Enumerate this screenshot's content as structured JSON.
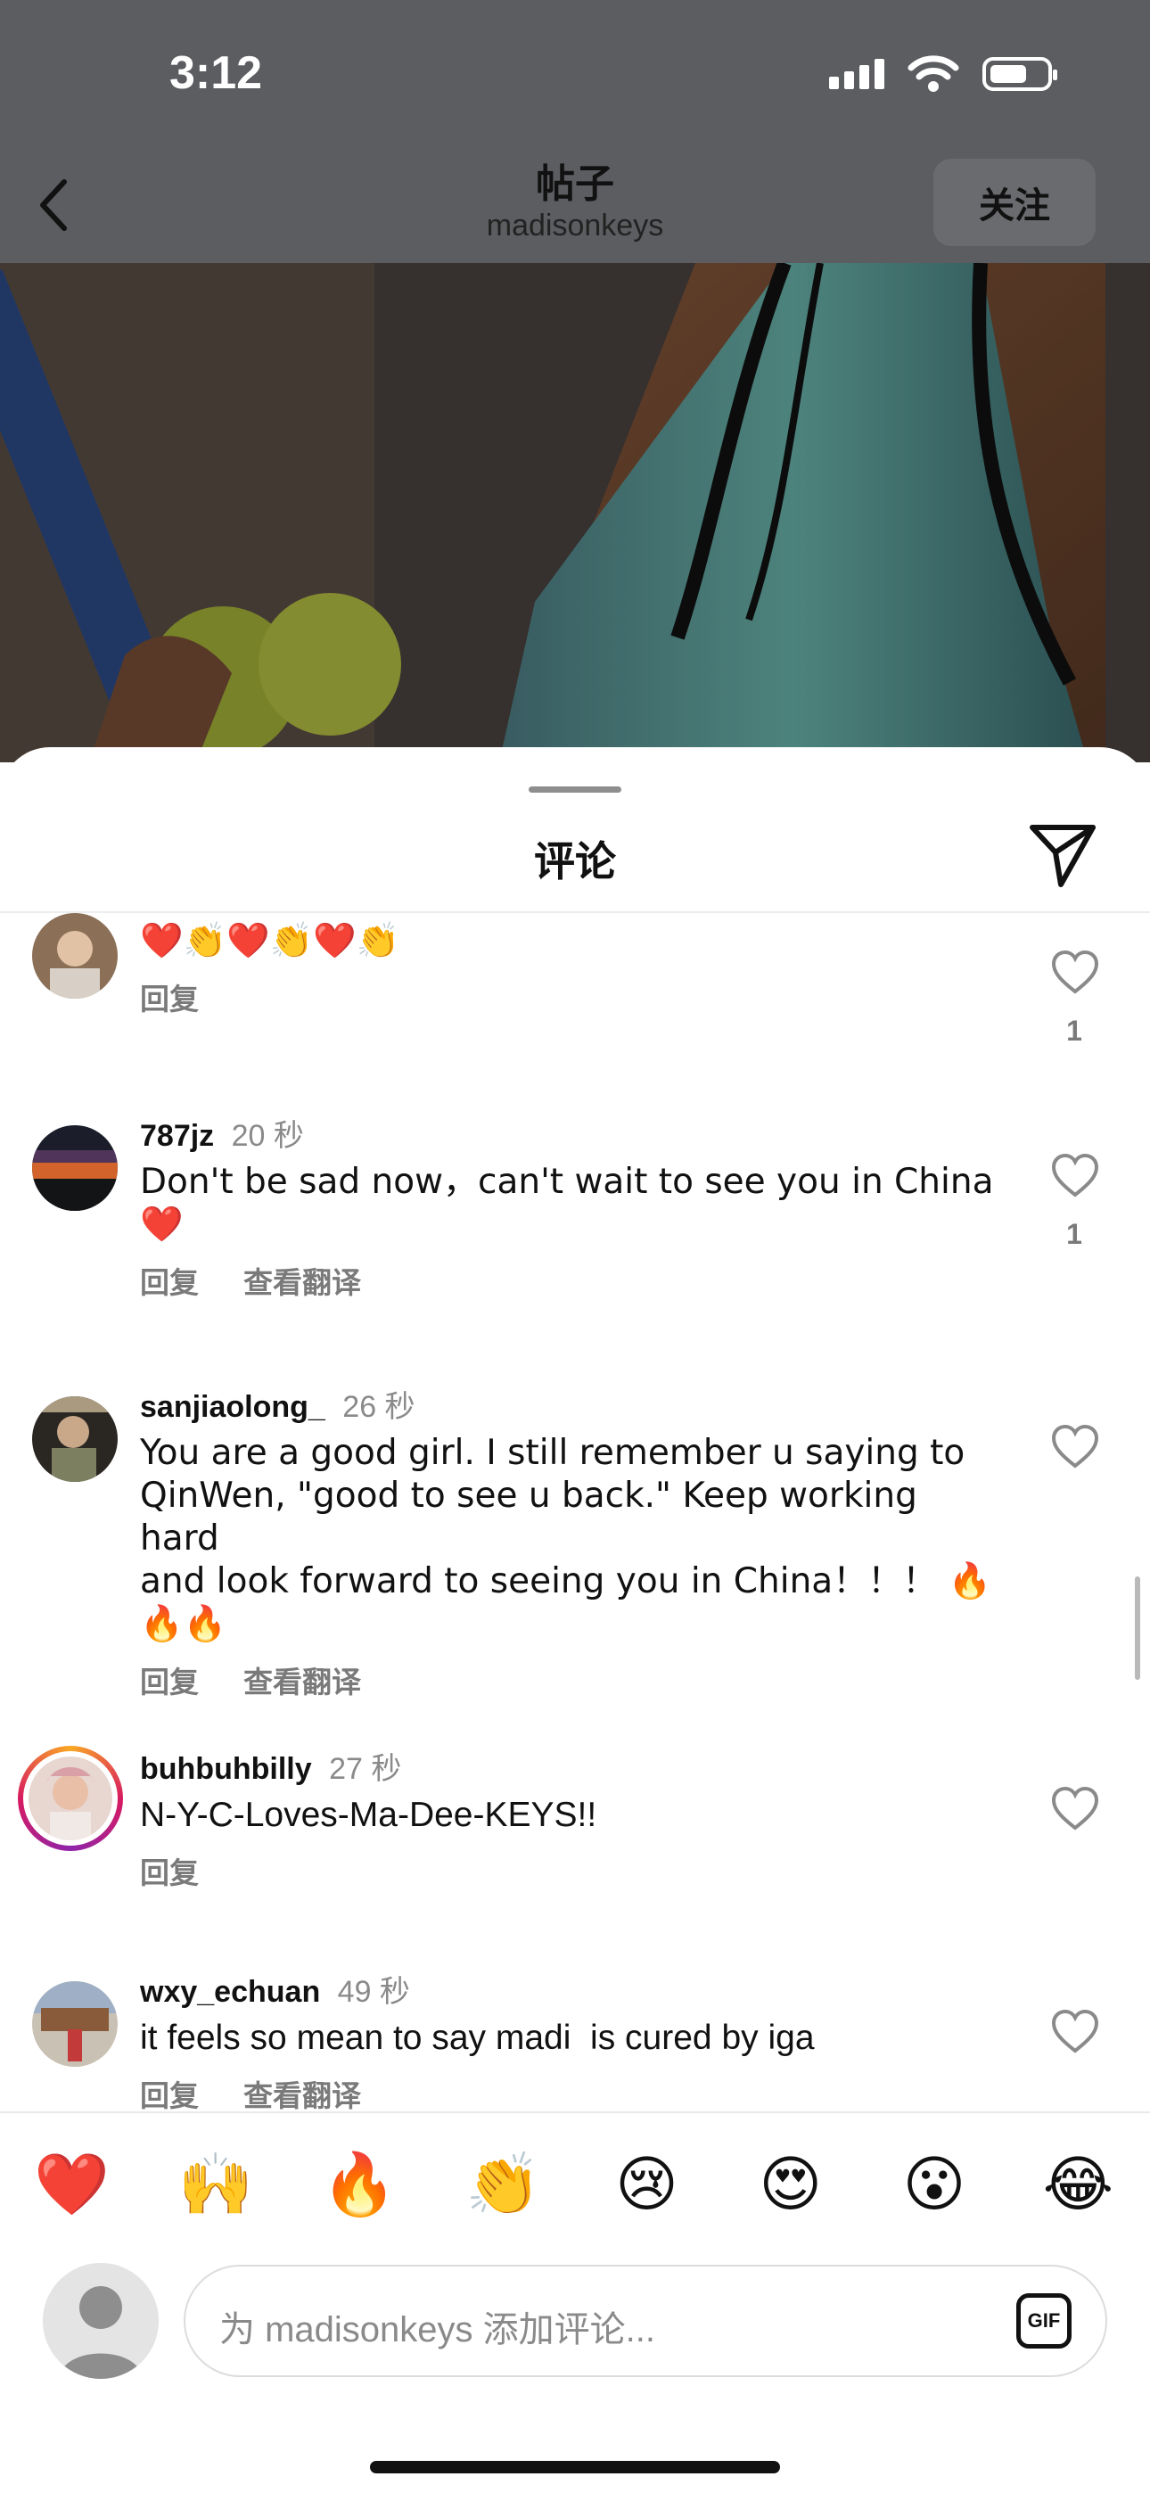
{
  "status_bar": {
    "time": "3:12"
  },
  "header": {
    "title": "帖子",
    "subtitle": "madisonkeys",
    "follow_label": "关注"
  },
  "sheet": {
    "title": "评论"
  },
  "comments": [
    {
      "user": "",
      "time": "",
      "text": "❤️👏❤️👏❤️👏",
      "actions": [
        "回复"
      ],
      "likes": "1"
    },
    {
      "user": "787jz",
      "time": "20 秒",
      "text": "Don't be sad now，can't wait to see you in China\n❤️",
      "actions": [
        "回复",
        "查看翻译"
      ],
      "likes": "1"
    },
    {
      "user": "sanjiaolong_",
      "time": "26 秒",
      "text": "You are a good girl. I still remember u saying to\nQinWen, \"good to see u back.\" Keep working hard\nand look forward to seeing you in China！！！ 🔥\n🔥🔥",
      "actions": [
        "回复",
        "查看翻译"
      ],
      "likes": ""
    },
    {
      "user": "buhbuhbilly",
      "time": "27 秒",
      "text": "N-Y-C-Loves-Ma-Dee-KEYS!!",
      "actions": [
        "回复"
      ],
      "likes": ""
    },
    {
      "user": "wxy_echuan",
      "time": "49 秒",
      "text": "it feels so mean to say madi  is cured by iga",
      "actions": [
        "回复",
        "查看翻译"
      ],
      "likes": ""
    }
  ],
  "reactions": [
    "❤️",
    "🙌",
    "🔥",
    "👏",
    "😢",
    "😍",
    "😮",
    "😂"
  ],
  "composer": {
    "placeholder": "为 madisonkeys 添加评论...",
    "gif_label": "GIF"
  },
  "icons": {
    "back": "chevron-left-icon",
    "share": "paper-plane-icon",
    "like": "heart-outline-icon"
  },
  "colors": {
    "dim_overlay": "#5b5d60",
    "muted_text": "#8a8a8a",
    "story_ring": [
      "#f9a825",
      "#d81b60",
      "#8e24aa"
    ]
  }
}
